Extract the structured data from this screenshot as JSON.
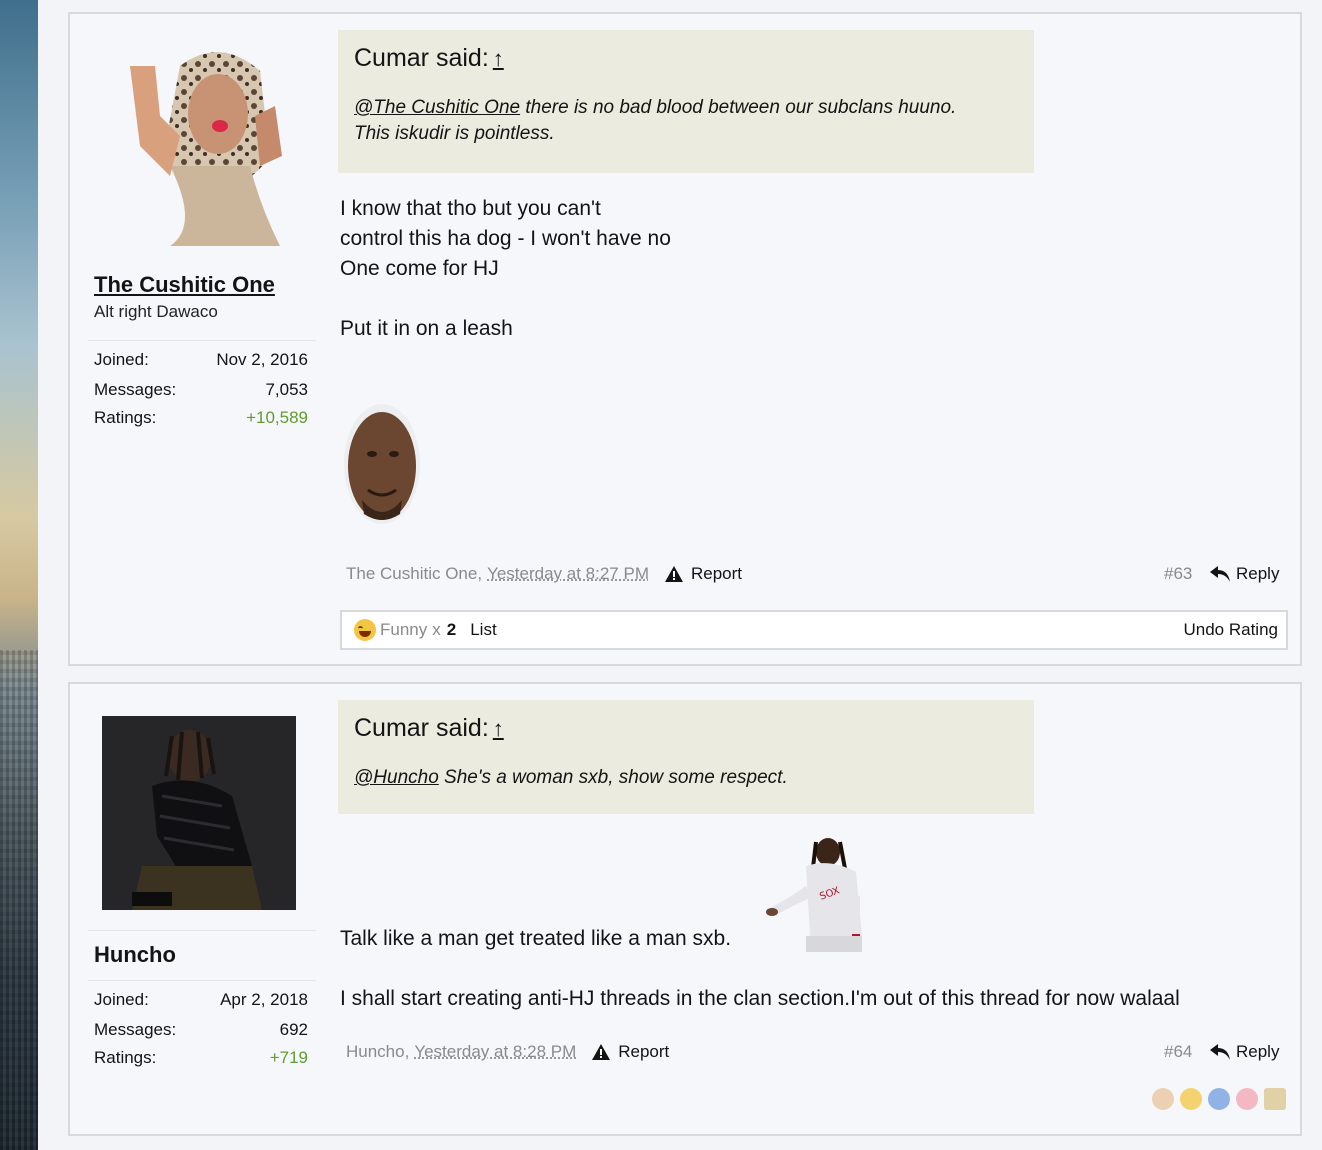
{
  "posts": [
    {
      "author": {
        "name": "The Cushitic One",
        "title": "Alt right Dawaco"
      },
      "stats": [
        {
          "label": "Joined:",
          "value": "Nov 2, 2016"
        },
        {
          "label": "Messages:",
          "value": "7,053"
        },
        {
          "label": "Ratings:",
          "value": "+10,589"
        }
      ],
      "quote": {
        "said": "Cumar said:",
        "arrow": "↑",
        "mention": "@The Cushitic One",
        "text_line1": " there is no bad blood between our subclans huuno.",
        "text_line2": "This iskudir is pointless."
      },
      "message": {
        "lines": [
          "I know that tho but you can't",
          "control this ha dog - I won't have no",
          "One come for HJ"
        ],
        "line4": "Put it in on a leash"
      },
      "meta": {
        "author": "The Cushitic One,",
        "time": "Yesterday at 8:27 PM",
        "report": "Report",
        "number": "#63",
        "reply": "Reply"
      },
      "rating": {
        "label": "Funny",
        "x": "x",
        "count": "2",
        "list": "List",
        "undo": "Undo Rating"
      }
    },
    {
      "author": {
        "name": "Huncho"
      },
      "stats": [
        {
          "label": "Joined:",
          "value": "Apr 2, 2018"
        },
        {
          "label": "Messages:",
          "value": "692"
        },
        {
          "label": "Ratings:",
          "value": "+719"
        }
      ],
      "quote": {
        "said": "Cumar said:",
        "arrow": "↑",
        "mention": "@Huncho",
        "text": " She's a woman sxb, show some respect."
      },
      "message": {
        "line1": "Talk like a man get treated like a man sxb.",
        "line2": "I shall start creating anti-HJ threads in the clan section.I'm out of this thread for now walaal"
      },
      "meta": {
        "author": "Huncho,",
        "time": "Yesterday at 8:28 PM",
        "report": "Report",
        "number": "#64",
        "reply": "Reply"
      }
    }
  ],
  "colors": {
    "accent_green": "#5e9c2e",
    "quote_bg": "#ebebdf",
    "meta_gray": "#8a8a8a"
  }
}
